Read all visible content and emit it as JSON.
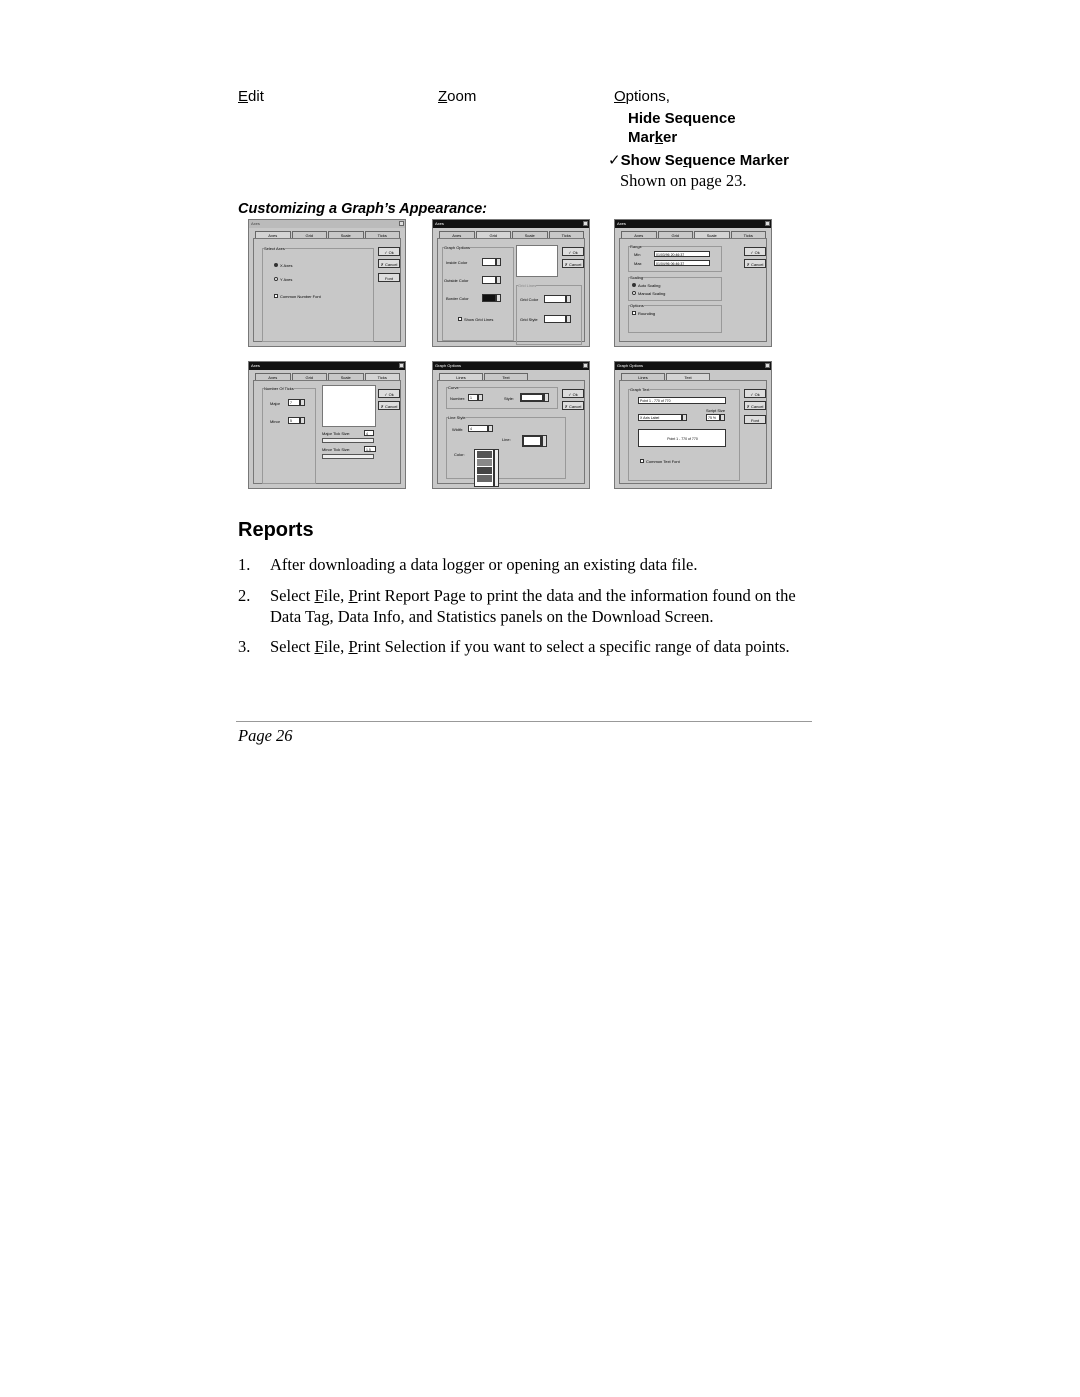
{
  "menus": {
    "edit": {
      "label": "Edit",
      "mnemonic": "E",
      "rest": "dit"
    },
    "zoom": {
      "label": "Zoom",
      "mnemonic": "Z",
      "rest": "oom"
    },
    "options": {
      "label": "Options,",
      "mnemonic": "O",
      "rest": "ptions,",
      "items": [
        {
          "line1": "Hide Sequence",
          "line2_pre": "Mar",
          "line2_mnemonic": "k",
          "line2_post": "er",
          "checked": false
        },
        {
          "pre": "Show Se",
          "mnemonic": "q",
          "post": "uence Marker",
          "checked": true,
          "check_glyph": "✓"
        }
      ],
      "note": "Shown on page 23."
    }
  },
  "caption": "Customizing a Graph’s Appearance:",
  "screenshots": [
    {
      "title": "Axes",
      "tabs": [
        "Axes",
        "Grid",
        "Scale",
        "Ticks"
      ],
      "active_tab": "Axes",
      "group": "Select Axes",
      "radios": [
        "X Axes",
        "Y Axes"
      ],
      "checkbox": "Common Number Font",
      "buttons": [
        "✓ Ok",
        "✗ Cancel",
        "Font"
      ]
    },
    {
      "title": "Axes",
      "tabs": [
        "Axes",
        "Grid",
        "Scale",
        "Ticks"
      ],
      "active_tab": "Grid",
      "group": "Graph Options",
      "fields": [
        "Inside Color",
        "Outside Color",
        "Border Color"
      ],
      "checkbox": "Show Grid Lines",
      "grid_group": "Grid Lines",
      "grid_fields": [
        "Grid Color",
        "Grid Style"
      ],
      "buttons": [
        "✓ Ok",
        "✗ Cancel"
      ]
    },
    {
      "title": "Axes",
      "tabs": [
        "Axes",
        "Grid",
        "Scale",
        "Ticks"
      ],
      "active_tab": "Scale",
      "range_group": "Range",
      "range_rows": [
        {
          "label": "Min",
          "value": "01/03/96 20:46:37"
        },
        {
          "label": "Max",
          "value": "01/04/96 06:46:37"
        }
      ],
      "scaling_group": "Scaling",
      "scaling_radios": [
        "Auto Scaling",
        "Manual Scaling"
      ],
      "options_group": "Options",
      "options_checkbox": "Rounding",
      "buttons": [
        "✓ Ok",
        "✗ Cancel"
      ]
    },
    {
      "title": "Axes",
      "tabs": [
        "Axes",
        "Grid",
        "Scale",
        "Ticks"
      ],
      "active_tab": "Ticks",
      "group": "Number Of Ticks",
      "rows": [
        {
          "label": "Major",
          "value": "7"
        },
        {
          "label": "Minor",
          "value": "5"
        }
      ],
      "major_tick_size_label": "Major Tick Size:",
      "major_tick_size": "4",
      "minor_tick_size_label": "Minor Tick Size:",
      "minor_tick_size": "1.5",
      "buttons": [
        "✓ Ok",
        "✗ Cancel"
      ]
    },
    {
      "title": "Graph Options",
      "tabs": [
        "Lines",
        "Text"
      ],
      "active_tab": "Lines",
      "curve_group": "Curve",
      "number_label": "Number:",
      "number_value": "1",
      "style_label": "Style:",
      "line_style_group": "Line Style",
      "width_label": "Width:",
      "width_value": "4",
      "line_label": "Line:",
      "color_label": "Color:",
      "buttons": [
        "✓ Ok",
        "✗ Cancel"
      ]
    },
    {
      "title": "Graph Options",
      "tabs": [
        "Lines",
        "Text"
      ],
      "active_tab": "Text",
      "group": "Graph Text",
      "text_value": "Point 1 - 770 of 770",
      "label_select": "X Axis Label",
      "script_size_label": "Script Size",
      "script_size": "75 %",
      "preview": "Point 1 - 770 of 770",
      "checkbox": "Common Text Font",
      "buttons": [
        "✓ Ok",
        "✗ Cancel",
        "Font"
      ]
    }
  ],
  "section": {
    "heading": "Reports",
    "steps": [
      {
        "num": "1.",
        "segments": [
          {
            "t": "After downloading a data logger or opening an existing data file."
          }
        ]
      },
      {
        "num": "2.",
        "segments": [
          {
            "t": "Select "
          },
          {
            "t": "F",
            "u": true
          },
          {
            "t": "ile, "
          },
          {
            "t": "P",
            "u": true
          },
          {
            "t": "rint Report Page to print the data and the information found on the Data Tag, Data Info, and Statistics panels on the Download Screen."
          }
        ]
      },
      {
        "num": "3.",
        "segments": [
          {
            "t": "Select "
          },
          {
            "t": "F",
            "u": true
          },
          {
            "t": "ile, "
          },
          {
            "t": "P",
            "u": true
          },
          {
            "t": "rint Selection if you want to select a specific range of data points."
          }
        ]
      }
    ]
  },
  "footer": {
    "page_label": "Page 26"
  }
}
